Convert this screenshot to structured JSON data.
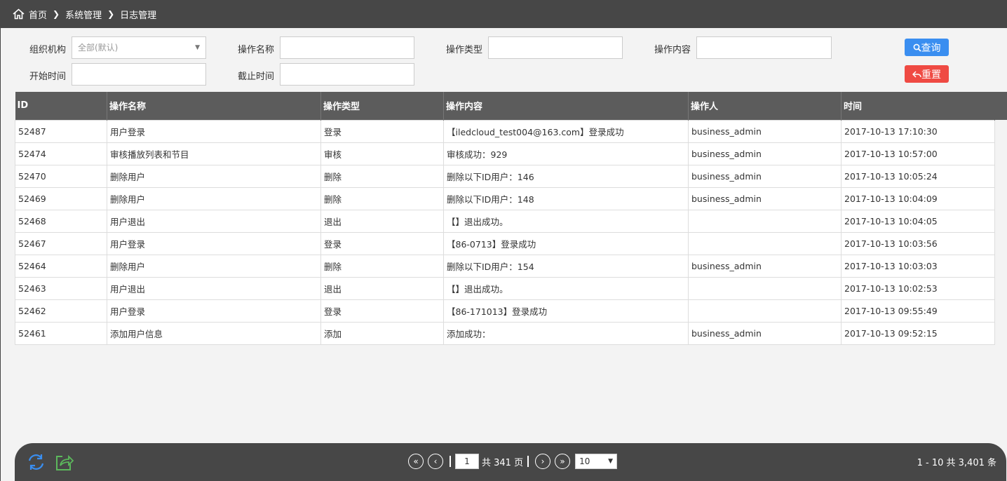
{
  "breadcrumb": {
    "home": "首页",
    "level1": "系统管理",
    "level2": "日志管理"
  },
  "filters": {
    "org_label": "组织机构",
    "org_value": "全部(默认)",
    "op_name_label": "操作名称",
    "op_name_value": "",
    "op_type_label": "操作类型",
    "op_type_value": "",
    "op_content_label": "操作内容",
    "op_content_value": "",
    "start_time_label": "开始时间",
    "start_time_value": "",
    "end_time_label": "截止时间",
    "end_time_value": "",
    "query_label": "查询",
    "reset_label": "重置"
  },
  "table": {
    "headers": [
      "ID",
      "操作名称",
      "操作类型",
      "操作内容",
      "操作人",
      "时间"
    ],
    "rows": [
      [
        "52487",
        "用户登录",
        "登录",
        "【iledcloud_test004@163.com】登录成功",
        "business_admin",
        "2017-10-13 17:10:30"
      ],
      [
        "52474",
        "审核播放列表和节目",
        "审核",
        "审核成功：929",
        "business_admin",
        "2017-10-13 10:57:00"
      ],
      [
        "52470",
        "删除用户",
        "删除",
        "删除以下ID用户：146",
        "business_admin",
        "2017-10-13 10:05:24"
      ],
      [
        "52469",
        "删除用户",
        "删除",
        "删除以下ID用户：148",
        "business_admin",
        "2017-10-13 10:04:09"
      ],
      [
        "52468",
        "用户退出",
        "退出",
        "【】退出成功。",
        "",
        "2017-10-13 10:04:05"
      ],
      [
        "52467",
        "用户登录",
        "登录",
        "【86-0713】登录成功",
        "",
        "2017-10-13 10:03:56"
      ],
      [
        "52464",
        "删除用户",
        "删除",
        "删除以下ID用户：154",
        "business_admin",
        "2017-10-13 10:03:03"
      ],
      [
        "52463",
        "用户退出",
        "退出",
        "【】退出成功。",
        "",
        "2017-10-13 10:02:53"
      ],
      [
        "52462",
        "用户登录",
        "登录",
        "【86-171013】登录成功",
        "",
        "2017-10-13 09:55:49"
      ],
      [
        "52461",
        "添加用户信息",
        "添加",
        "添加成功：",
        "business_admin",
        "2017-10-13 09:52:15"
      ]
    ]
  },
  "pager": {
    "current_page": "1",
    "total_pages_text": "共 341 页",
    "page_size": "10",
    "summary": "1 - 10   共 3,401 条"
  },
  "colors": {
    "topbar": "#474747",
    "query": "#3a8ef0",
    "reset": "#ef4a43",
    "header": "#5c5c5c"
  }
}
